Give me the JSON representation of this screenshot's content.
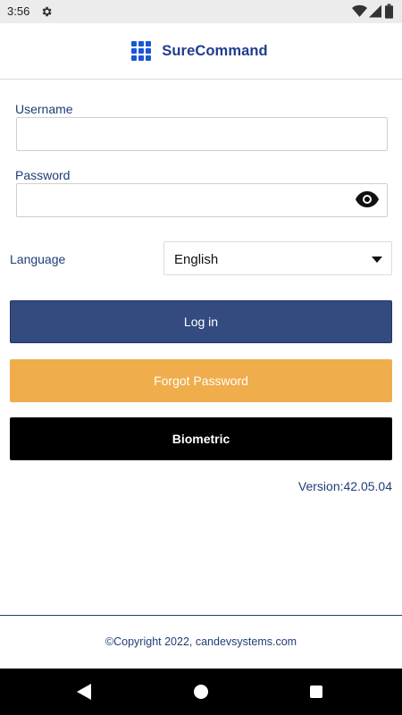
{
  "status_bar": {
    "time": "3:56",
    "icons": [
      "gear-icon",
      "wifi-icon",
      "signal-icon",
      "battery-icon"
    ]
  },
  "header": {
    "title": "SureCommand",
    "icon": "grid-icon",
    "accent_color": "#1a56d6",
    "title_color": "#1f3d8c"
  },
  "form": {
    "username": {
      "label": "Username",
      "value": "",
      "placeholder": ""
    },
    "password": {
      "label": "Password",
      "value": "",
      "placeholder": "",
      "toggle_icon": "eye-icon"
    },
    "language": {
      "label": "Language",
      "selected": "English",
      "icon": "dropdown-arrow-icon"
    }
  },
  "buttons": {
    "login": {
      "label": "Log in",
      "color": "#344b80"
    },
    "forgot_password": {
      "label": "Forgot Password",
      "color": "#efad4c"
    },
    "biometric": {
      "label": "Biometric",
      "color": "#000000"
    }
  },
  "version": "Version:42.05.04",
  "footer": {
    "copyright": "©Copyright 2022, candevsystems.com"
  },
  "nav_bar": {
    "icons": [
      "back-icon",
      "home-icon",
      "recents-icon"
    ]
  }
}
